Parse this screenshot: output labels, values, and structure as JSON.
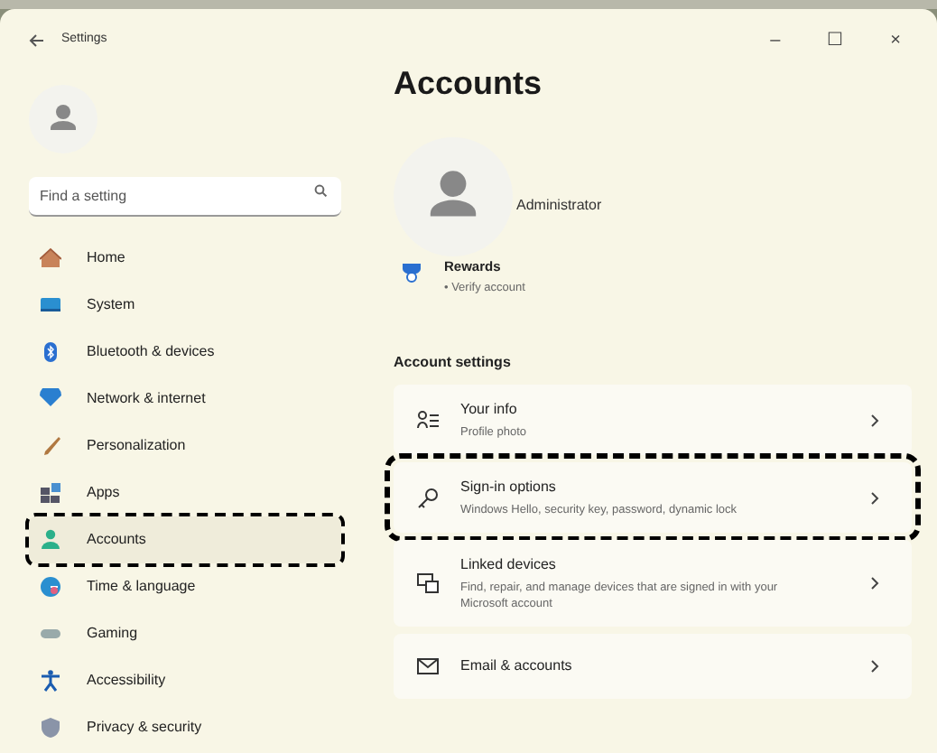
{
  "window": {
    "title": "Settings",
    "controls": [
      "–",
      "☐",
      "×"
    ]
  },
  "sidebar": {
    "search": {
      "placeholder": "Find a setting"
    },
    "items": [
      {
        "label": "Home",
        "selected": false,
        "highlighted": false
      },
      {
        "label": "System",
        "selected": false,
        "highlighted": false
      },
      {
        "label": "Bluetooth & devices",
        "selected": false,
        "highlighted": false
      },
      {
        "label": "Network & internet",
        "selected": false,
        "highlighted": false
      },
      {
        "label": "Personalization",
        "selected": false,
        "highlighted": false
      },
      {
        "label": "Apps",
        "selected": false,
        "highlighted": false
      },
      {
        "label": "Accounts",
        "selected": true,
        "highlighted": true
      },
      {
        "label": "Time & language",
        "selected": false,
        "highlighted": false
      },
      {
        "label": "Gaming",
        "selected": false,
        "highlighted": false
      },
      {
        "label": "Accessibility",
        "selected": false,
        "highlighted": false
      },
      {
        "label": "Privacy & security",
        "selected": false,
        "highlighted": false
      }
    ]
  },
  "page": {
    "title": "Accounts",
    "user": "Administrator",
    "rewards": {
      "title": "Rewards",
      "subtitle": "• Verify account"
    },
    "section": "Account settings",
    "cards": [
      {
        "title": "Your info",
        "subtitle": "Profile photo",
        "highlighted": false
      },
      {
        "title": "Sign-in options",
        "subtitle": "Windows Hello, security key, password, dynamic lock",
        "highlighted": true
      },
      {
        "title": "Linked devices",
        "subtitle": "Find, repair, and manage devices that are signed in with your Microsoft account",
        "highlighted": false
      },
      {
        "title": "Email & accounts",
        "highlighted": false
      }
    ]
  }
}
